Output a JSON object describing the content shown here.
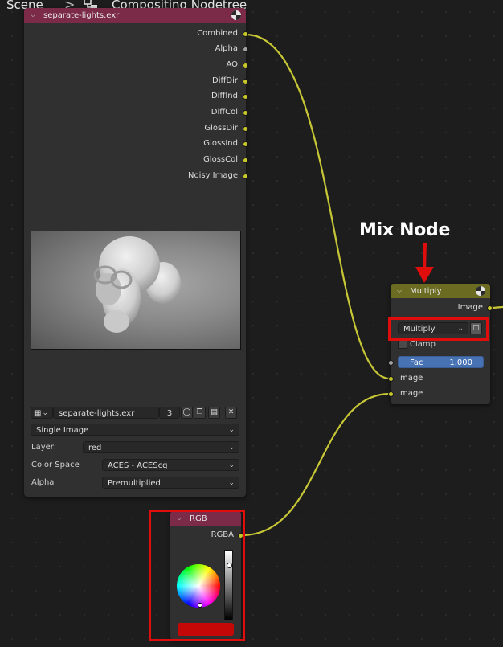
{
  "breadcrumb": {
    "scene": "Scene",
    "separator": ">",
    "tree_icon": "node-tree-icon",
    "tree": "Compositing Nodetree"
  },
  "annotation": {
    "text": "Mix Node",
    "arrow_color": "#e00d0d"
  },
  "image_node": {
    "title": "separate-lights.exr",
    "header_color": "#7b2a47",
    "outputs": [
      "Combined",
      "Alpha",
      "AO",
      "DiffDir",
      "DiffInd",
      "DiffCol",
      "GlossDir",
      "GlossInd",
      "GlossCol",
      "Noisy Image"
    ],
    "image_name": "separate-lights.exr",
    "users": "3",
    "source": "Single Image",
    "layer_label": "Layer:",
    "layer_value": "red",
    "colorspace_label": "Color Space",
    "colorspace_value": "ACES - ACEScg",
    "alpha_label": "Alpha",
    "alpha_value": "Premultiplied"
  },
  "mix_node": {
    "title": "Multiply",
    "header_color": "#6b6b22",
    "output": "Image",
    "blend_type": "Multiply",
    "clamp_label": "Clamp",
    "clamp_checked": false,
    "fac_label": "Fac",
    "fac_value": "1.000",
    "inputs": [
      "Image",
      "Image"
    ]
  },
  "rgb_node": {
    "title": "RGB",
    "header_color": "#7b2a47",
    "output": "RGBA",
    "color": "#c40808"
  },
  "colors": {
    "socket_color": "#c7c729",
    "wire_color": "#c8c836",
    "highlight_red": "#e00d0d"
  }
}
